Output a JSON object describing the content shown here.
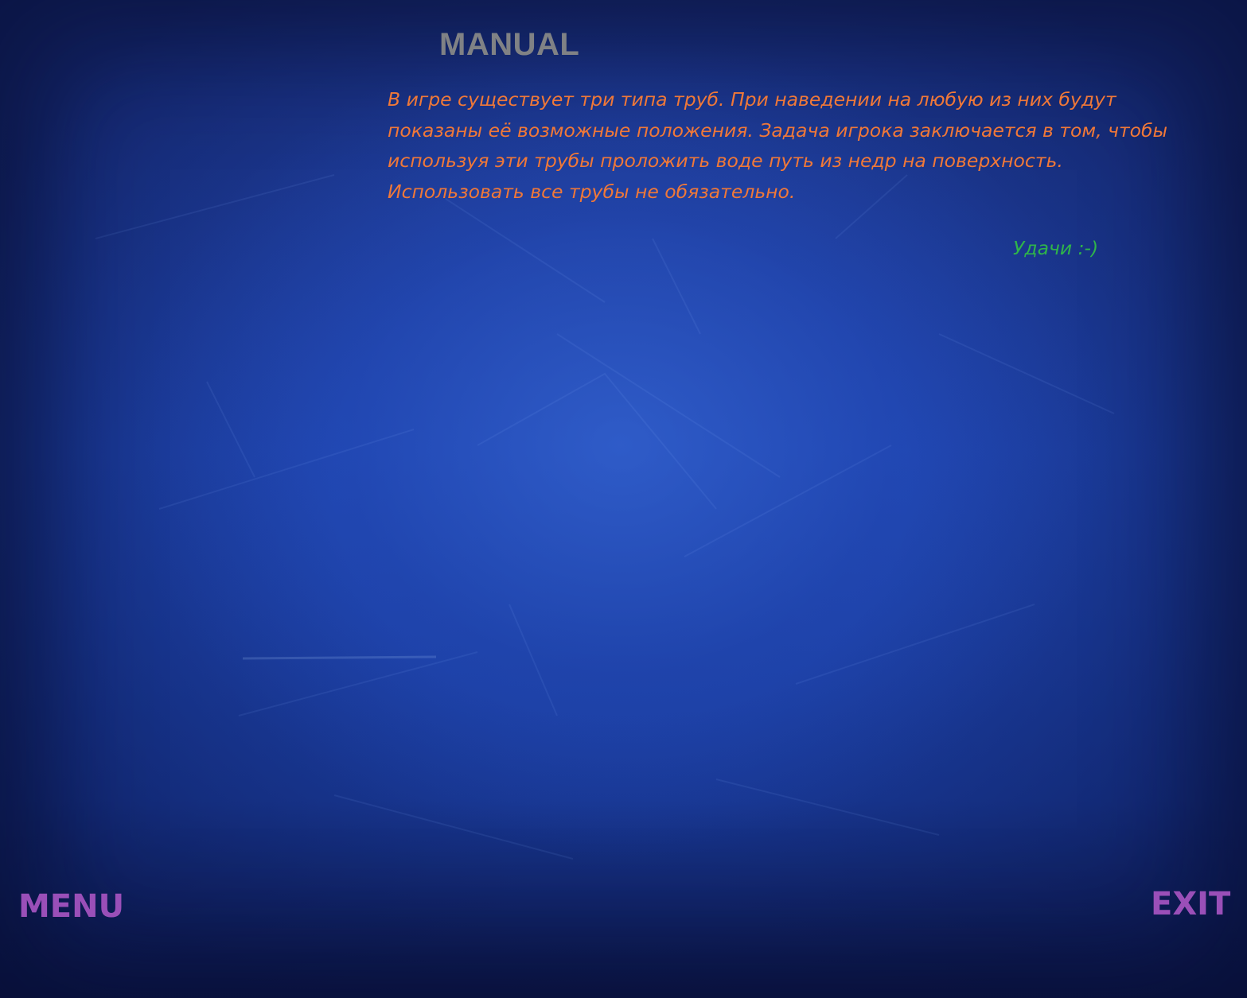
{
  "screen": {
    "title": "MANUAL",
    "instructions": "В игре существует три типа труб. При наведении на любую из них будут показаны её возможные положения. Задача игрока заключается в том, чтобы используя эти трубы проложить воде путь из недр на поверхность. Использовать все трубы не обязательно.",
    "good_luck": "Удачи :-)"
  },
  "buttons": {
    "menu_label": "MENU",
    "exit_label": "EXIT"
  },
  "colors": {
    "background": "#1f45b0",
    "title": "#808285",
    "instructions": "#f07838",
    "good_luck": "#2fb44a",
    "buttons": "#9a4fb8"
  }
}
